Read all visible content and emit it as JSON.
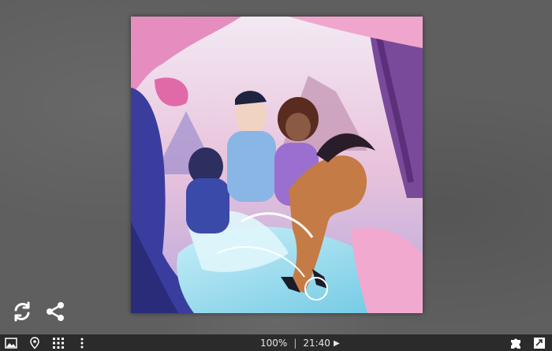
{
  "viewer": {
    "image_description_icon": "illustration-icon"
  },
  "overlay": {
    "refresh_icon": "refresh-icon",
    "share_icon": "share-icon"
  },
  "bottom_bar": {
    "zoom": "100%",
    "separator": "|",
    "timer": "21:40",
    "left_icons": [
      "image-icon",
      "location-pin-icon",
      "grid-icon",
      "more-vertical-icon"
    ],
    "right_icons": [
      "puzzle-piece-icon",
      "fullscreen-icon"
    ]
  },
  "colors": {
    "bar_background": "#2b2b2b",
    "page_background": "#5f5f5f",
    "icon_color": "#ffffff"
  }
}
